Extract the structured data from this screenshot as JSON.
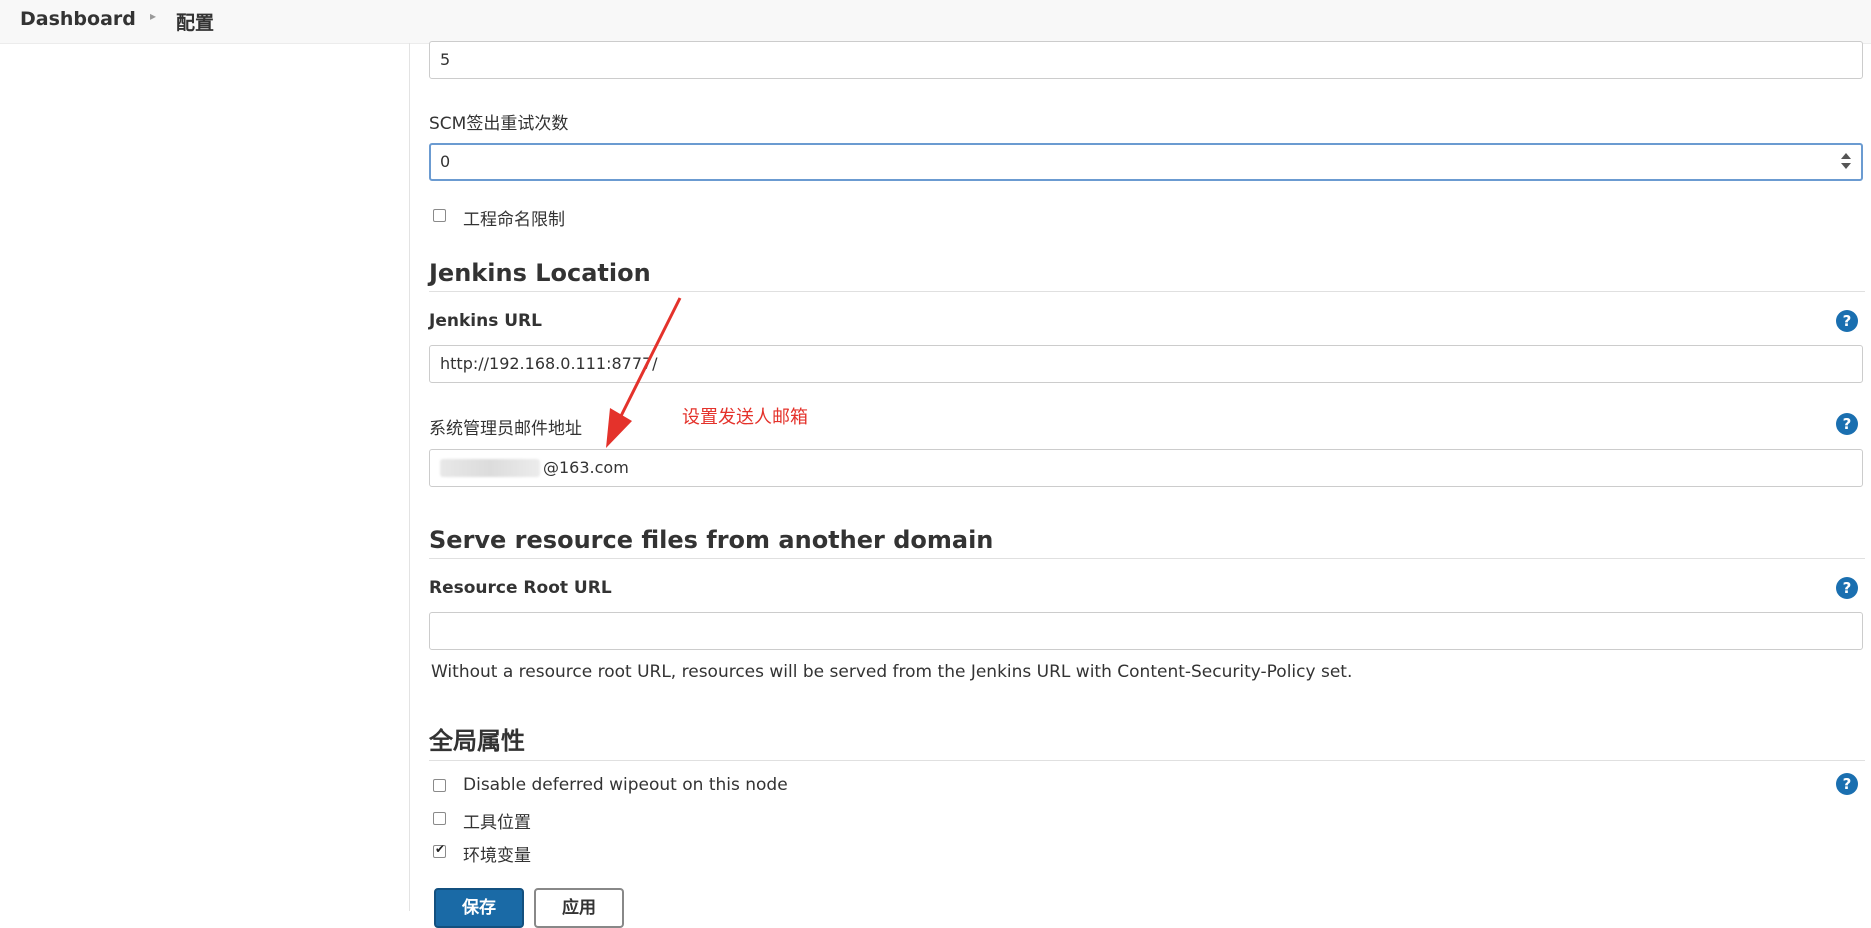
{
  "breadcrumb": {
    "home": "Dashboard",
    "current": "配置"
  },
  "scm_quiet": {
    "value": "5"
  },
  "scm_retry": {
    "label": "SCM签出重试次数",
    "value": "0"
  },
  "project_naming": {
    "label": "工程命名限制",
    "checked": false
  },
  "jenkins_location": {
    "title": "Jenkins Location",
    "url_label": "Jenkins URL",
    "url_value": "http://192.168.0.111:8777/",
    "email_label": "系统管理员邮件地址",
    "email_suffix": "@163.com",
    "annotation": "设置发送人邮箱",
    "annotation_color": "#e4322b"
  },
  "resource_domain": {
    "title": "Serve resource files from another domain",
    "root_url_label": "Resource Root URL",
    "root_url_value": "",
    "description": "Without a resource root URL, resources will be served from the Jenkins URL with Content-Security-Policy set."
  },
  "global_properties": {
    "title": "全局属性",
    "options": [
      {
        "label": "Disable deferred wipeout on this node",
        "checked": false
      },
      {
        "label": "工具位置",
        "checked": false
      },
      {
        "label": "环境变量",
        "checked": true
      }
    ]
  },
  "help_icon": {
    "glyph": "?",
    "icon": "help-icon"
  },
  "buttons": {
    "save": "保存",
    "apply": "应用"
  },
  "colors": {
    "primary": "#1a6aa6",
    "focus": "#6b9bd1",
    "help": "#1a6fb0"
  }
}
